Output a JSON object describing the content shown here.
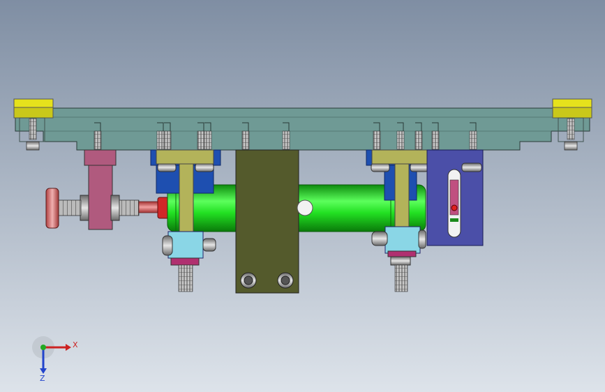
{
  "viewport": {
    "background_top": "#7f8ea3",
    "background_bottom": "#dde3ea"
  },
  "colors": {
    "base_plate": "#6f9a95",
    "end_pad": "#e6e21c",
    "clamp_block": "#b05a7e",
    "bracket_blue": "#1e4fb0",
    "bracket_purple": "#4b4fa8",
    "arm_olive": "#b3b35a",
    "cylinder_green": "#22e022",
    "center_plate": "#545a2c",
    "fastener_gray": "#9a9a9a",
    "adjust_knob": "#d86a6a"
  },
  "axis_triad": {
    "x_label": "X",
    "z_label": "Z",
    "x_color": "#cc2222",
    "y_color": "#22aa22",
    "z_color": "#2244cc"
  }
}
